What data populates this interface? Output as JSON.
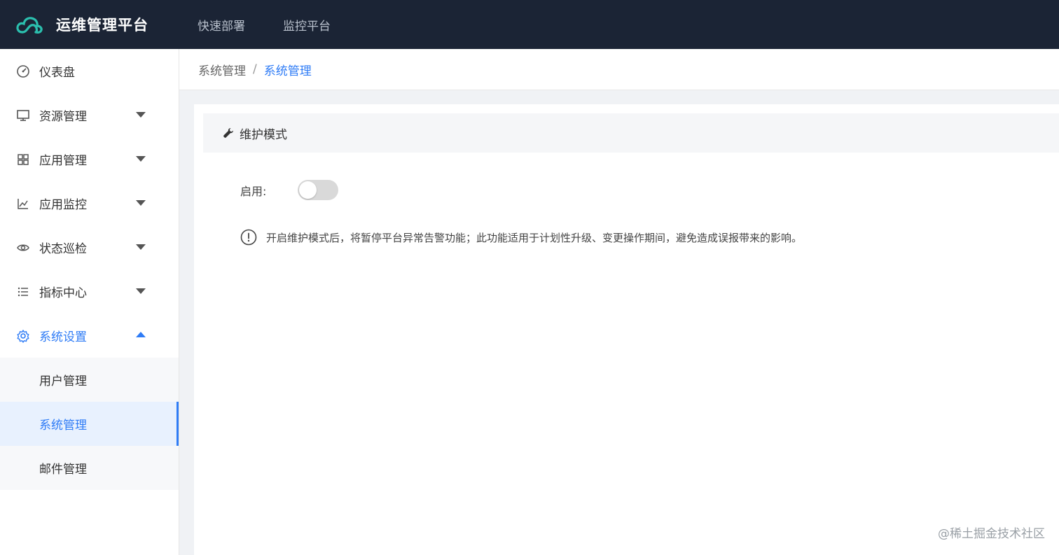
{
  "app": {
    "title": "运维管理平台"
  },
  "topnav": {
    "items": [
      "快速部署",
      "监控平台"
    ]
  },
  "sidebar": {
    "items": [
      {
        "label": "仪表盘",
        "icon": "dashboard-icon"
      },
      {
        "label": "资源管理",
        "icon": "monitor-icon"
      },
      {
        "label": "应用管理",
        "icon": "grid-icon"
      },
      {
        "label": "应用监控",
        "icon": "line-chart-icon"
      },
      {
        "label": "状态巡检",
        "icon": "eye-icon"
      },
      {
        "label": "指标中心",
        "icon": "list-icon"
      },
      {
        "label": "系统设置",
        "icon": "gear-icon"
      }
    ],
    "submenu": [
      "用户管理",
      "系统管理",
      "邮件管理"
    ]
  },
  "breadcrumb": {
    "parent": "系统管理",
    "separator": "/",
    "current": "系统管理"
  },
  "panel": {
    "title": "维护模式",
    "enable_label": "启用:",
    "enabled": false,
    "notice": "开启维护模式后，将暂停平台异常告警功能；此功能适用于计划性升级、变更操作期间，避免造成误报带来的影响。"
  },
  "watermark": "@稀土掘金技术社区",
  "colors": {
    "accent": "#2f7cf6",
    "topbar": "#1b2435",
    "brand_logo": "#2bbfae"
  }
}
